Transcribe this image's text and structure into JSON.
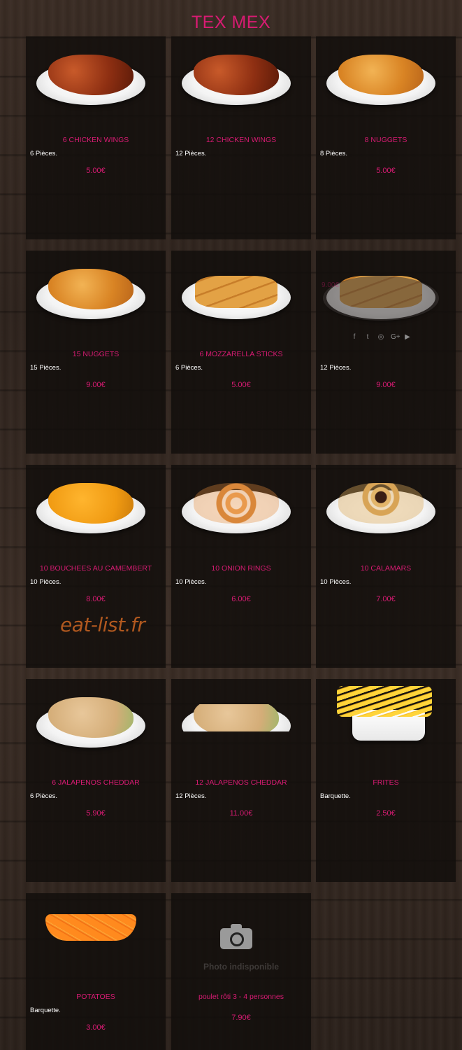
{
  "page": {
    "title": "TEX MEX"
  },
  "watermark": "eat-list.fr",
  "items": [
    {
      "name": "6 CHICKEN WINGS",
      "desc": "6 Pièces.",
      "price": "5.00€"
    },
    {
      "name": "12 CHICKEN WINGS",
      "desc": "12 Pièces.",
      "price": ""
    },
    {
      "name": "8 NUGGETS",
      "desc": "8 Pièces.",
      "price": "5.00€"
    },
    {
      "name": "15 NUGGETS",
      "desc": "15 Pièces.",
      "price": "9.00€"
    },
    {
      "name": "6 MOZZARELLA STICKS",
      "desc": "6 Pièces.",
      "price": "5.00€"
    },
    {
      "name": "",
      "desc": "12 Pièces.",
      "price": "9.00€",
      "overlay_price": "9.00€"
    },
    {
      "name": "10 BOUCHEES AU CAMEMBERT",
      "desc": "10 Pièces.",
      "price": "8.00€"
    },
    {
      "name": "10 ONION RINGS",
      "desc": "10 Pièces.",
      "price": "6.00€"
    },
    {
      "name": "10 CALAMARS",
      "desc": "10 Pièces.",
      "price": "7.00€"
    },
    {
      "name": "6 JALAPENOS CHEDDAR",
      "desc": "6 Pièces.",
      "price": "5.90€"
    },
    {
      "name": "12 JALAPENOS CHEDDAR",
      "desc": "12 Pièces.",
      "price": "11.00€"
    },
    {
      "name": "FRITES",
      "desc": "Barquette.",
      "price": "2.50€"
    },
    {
      "name": "POTATOES",
      "desc": "Barquette.",
      "price": "3.00€"
    },
    {
      "name": "poulet rôti 3 - 4 personnes",
      "desc": "",
      "price": "7.90€",
      "placeholder_text": "Photo indisponible"
    }
  ],
  "social_icons": [
    "facebook-icon",
    "twitter-icon",
    "instagram-icon",
    "google-plus-icon",
    "youtube-icon"
  ],
  "social_glyphs": [
    "f",
    "t",
    "◎",
    "G+",
    "▶"
  ],
  "colors": {
    "accent": "#d81b73",
    "text": "#ffffff",
    "watermark": "#b0581f"
  }
}
